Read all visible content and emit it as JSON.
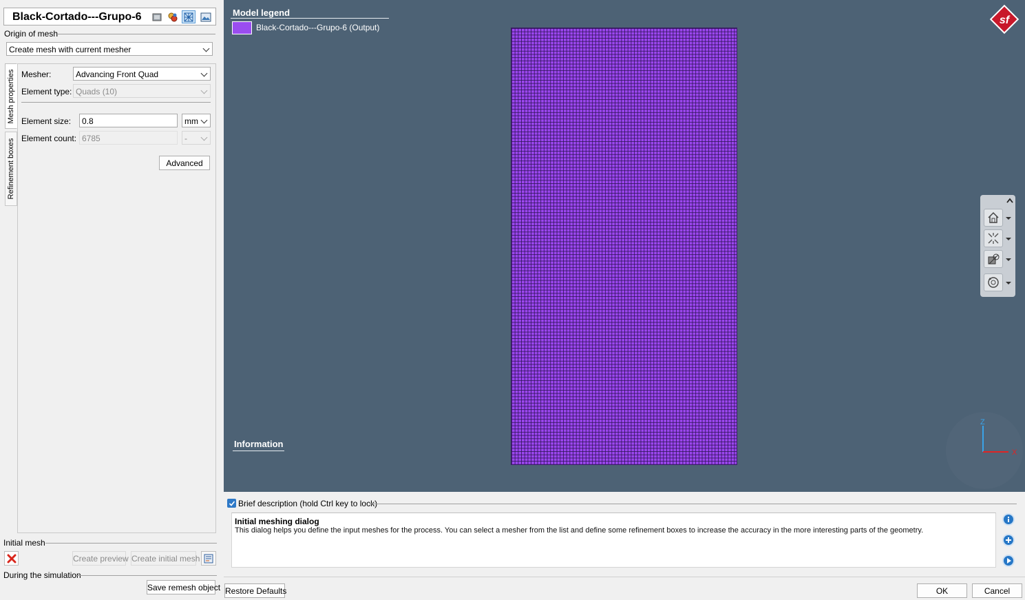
{
  "header": {
    "title": "Black-Cortado---Grupo-6"
  },
  "origin": {
    "label": "Origin of mesh",
    "value": "Create mesh with current mesher"
  },
  "tabs": [
    {
      "label": "Mesh properties"
    },
    {
      "label": "Refinement boxes"
    }
  ],
  "mesh_props": {
    "mesher_label": "Mesher:",
    "mesher_value": "Advancing Front Quad",
    "element_type_label": "Element type:",
    "element_type_value": "Quads (10)",
    "element_size_label": "Element size:",
    "element_size_value": "0.8",
    "element_size_unit": "mm",
    "element_count_label": "Element count:",
    "element_count_value": "6785",
    "element_count_unit": "-",
    "advanced_label": "Advanced"
  },
  "initial_mesh": {
    "label": "Initial mesh",
    "create_preview": "Create preview",
    "create_initial": "Create initial mesh"
  },
  "simulation": {
    "label": "During the simulation",
    "save_remesh": "Save remesh object"
  },
  "viewport": {
    "legend_title": "Model legend",
    "legend_item": "Black-Cortado---Grupo-6 (Output)",
    "legend_color": "#9a4df0",
    "info_title": "Information",
    "logo_text": "sf",
    "axis_z": "Z",
    "axis_x": "X",
    "background": "#4d6275"
  },
  "description": {
    "checkbox_label": "Brief description (hold Ctrl key to lock)",
    "title": "Initial meshing dialog",
    "body": "This dialog helps you define the input meshes for the process. You can select a mesher from the list and define some refinement boxes to increase the accuracy in the more interesting parts of the geometry."
  },
  "footer": {
    "restore": "Restore Defaults",
    "ok": "OK",
    "cancel": "Cancel"
  }
}
